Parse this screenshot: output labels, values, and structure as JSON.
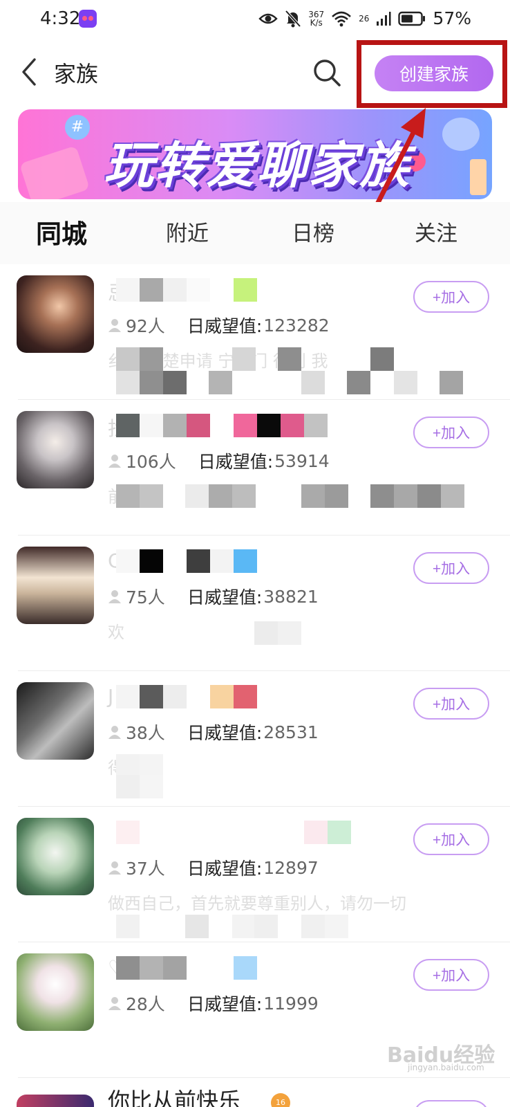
{
  "status_bar": {
    "time": "4:32",
    "net_speed_top": "367",
    "net_speed_bottom": "K/s",
    "signal_label": "26",
    "battery": "57%"
  },
  "nav": {
    "title": "家族",
    "create_button": "创建家族"
  },
  "banner": {
    "headline": "玩转爱聊家族"
  },
  "tabs": [
    {
      "label": "同城",
      "active": true
    },
    {
      "label": "附近",
      "active": false
    },
    {
      "label": "日榜",
      "active": false
    },
    {
      "label": "关注",
      "active": false
    }
  ],
  "families": [
    {
      "members": "92人",
      "weiwang_label": "日威望值:",
      "weiwang": "123282",
      "desc_fragment": "纟   看清楚申请   宁开门   征别   我",
      "join": "+加入"
    },
    {
      "members": "106人",
      "weiwang_label": "日威望值:",
      "weiwang": "53914",
      "desc_fragment": "前",
      "join": "+加入"
    },
    {
      "members": "75人",
      "weiwang_label": "日威望值:",
      "weiwang": "38821",
      "desc_fragment": "欢",
      "join": "+加入"
    },
    {
      "members": "38人",
      "weiwang_label": "日威望值:",
      "weiwang": "28531",
      "desc_fragment": "                             得",
      "join": "+加入"
    },
    {
      "members": "37人",
      "weiwang_label": "日威望值:",
      "weiwang": "12897",
      "desc_fragment": "做西自己，首先就要尊重别人，请勿一切",
      "join": "+加入"
    },
    {
      "members": "28人",
      "weiwang_label": "日威望值:",
      "weiwang": "11999",
      "desc_fragment": "",
      "join": "+加入"
    }
  ],
  "partial_row": {
    "name": "你比从前快乐",
    "badge": "16"
  },
  "watermark": {
    "main": "Baidu经验",
    "sub": "jingyan.baidu.com"
  },
  "colors": {
    "accent": "#b268ef",
    "highlight_box": "#b81414",
    "join_border": "#c89df2"
  }
}
